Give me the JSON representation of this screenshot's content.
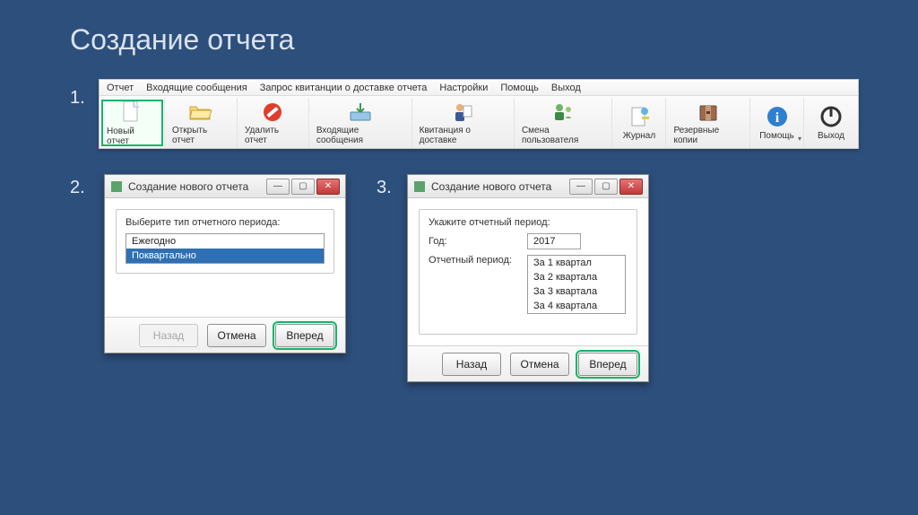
{
  "slide": {
    "title": "Создание отчета",
    "steps": [
      "1.",
      "2.",
      "3."
    ]
  },
  "menubar": {
    "items": [
      "Отчет",
      "Входящие сообщения",
      "Запрос квитанции о доставке отчета",
      "Настройки",
      "Помощь",
      "Выход"
    ]
  },
  "toolbar": {
    "buttons": [
      {
        "label": "Новый отчет",
        "icon": "file-new-icon"
      },
      {
        "label": "Открыть отчет",
        "icon": "folder-open-icon"
      },
      {
        "label": "Удалить отчет",
        "icon": "forbidden-icon"
      },
      {
        "label": "Входящие сообщения",
        "icon": "inbox-tray-icon"
      },
      {
        "label": "Квитанция о доставке",
        "icon": "person-docs-icon"
      },
      {
        "label": "Смена пользователя",
        "icon": "user-switch-icon"
      },
      {
        "label": "Журнал",
        "icon": "journal-icon"
      },
      {
        "label": "Резервные копии",
        "icon": "archive-icon"
      },
      {
        "label": "Помощь",
        "icon": "info-icon",
        "has_dropdown": true
      },
      {
        "label": "Выход",
        "icon": "power-icon"
      }
    ],
    "highlight_index": 0
  },
  "dialog2": {
    "title": "Создание нового отчета",
    "prompt": "Выберите тип отчетного периода:",
    "options": [
      "Ежегодно",
      "Поквартально"
    ],
    "selected_index": 1,
    "buttons": {
      "back": "Назад",
      "cancel": "Отмена",
      "next": "Вперед"
    },
    "back_disabled": true
  },
  "dialog3": {
    "title": "Создание нового отчета",
    "prompt": "Укажите отчетный период:",
    "year_label": "Год:",
    "year_value": "2017",
    "period_label": "Отчетный период:",
    "periods": [
      "За 1 квартал",
      "За 2 квартала",
      "За 3 квартала",
      "За 4 квартала"
    ],
    "selected_period_index": 0,
    "buttons": {
      "back": "Назад",
      "cancel": "Отмена",
      "next": "Вперед"
    }
  }
}
